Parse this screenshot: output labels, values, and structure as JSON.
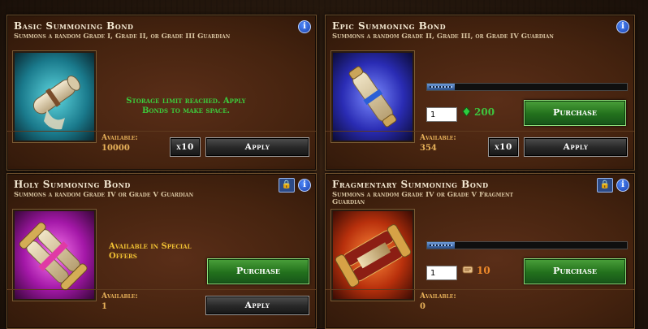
{
  "colors": {
    "accent_green": "#2a8a24",
    "gold": "#e8b25a",
    "panel": "#45230f"
  },
  "cards": [
    {
      "title": "Basic Summoning Bond",
      "desc": "Summons a random Grade I, Grade II, or Grade III Guardian",
      "available_label": "Available:",
      "available": "10000",
      "multiplier": "x10",
      "apply": "Apply",
      "message": "Storage limit reached. Apply Bonds to make space."
    },
    {
      "title": "Epic Summoning Bond",
      "desc": "Summons a random Grade II, Grade III, or Grade IV Guardian",
      "available_label": "Available:",
      "available": "354",
      "multiplier": "x10",
      "apply": "Apply",
      "quantity": "1",
      "price": "200",
      "purchase": "Purchase"
    },
    {
      "title": "Holy Summoning Bond",
      "desc": "Summons a random Grade IV or Grade V Guardian",
      "available_label": "Available:",
      "available": "1",
      "apply": "Apply",
      "special": "Available in Special Offers",
      "purchase": "Purchase"
    },
    {
      "title": "Fragmentary Summoning Bond",
      "desc": "Summons a random Grade IV or Grade V Fragment Guardian",
      "available_label": "Available:",
      "available": "0",
      "quantity": "1",
      "price": "10",
      "purchase": "Purchase"
    }
  ],
  "icons": {
    "info": "i",
    "lock": "lock-icon",
    "currency_green": "green-gem-icon",
    "currency_scroll": "scroll-token-icon"
  }
}
